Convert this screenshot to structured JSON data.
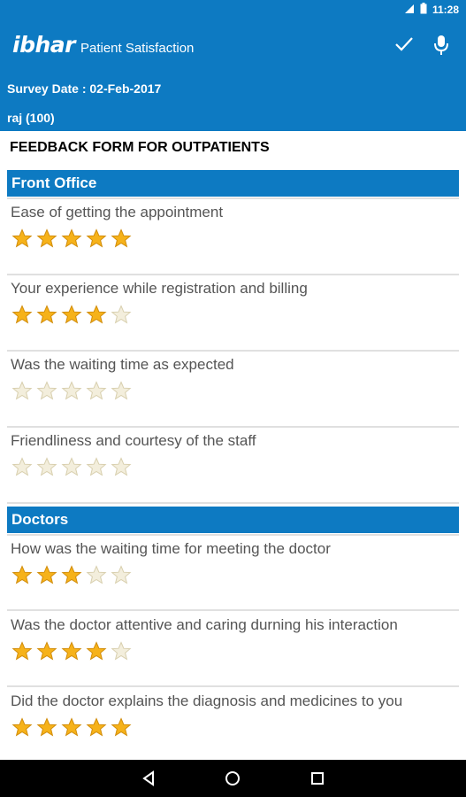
{
  "status_bar": {
    "time": "11:28"
  },
  "app_bar": {
    "logo": "ibhar",
    "title": "Patient Satisfaction",
    "survey_date": "Survey Date : 02-Feb-2017",
    "patient": "raj (100)"
  },
  "form_title": "FEEDBACK FORM FOR OUTPATIENTS",
  "colors": {
    "primary": "#0d7ac2",
    "star_filled": "#f6b21a",
    "star_empty": "#f3eedc"
  },
  "sections": [
    {
      "title": "Front Office",
      "questions": [
        {
          "text": "Ease of getting the appointment",
          "rating": 5
        },
        {
          "text": "Your experience while registration and billing",
          "rating": 4
        },
        {
          "text": "Was the waiting time as expected",
          "rating": 0
        },
        {
          "text": "Friendliness and courtesy of the staff",
          "rating": 0
        }
      ]
    },
    {
      "title": "Doctors",
      "questions": [
        {
          "text": "How was the waiting time for meeting the doctor",
          "rating": 3
        },
        {
          "text": "Was the doctor attentive and caring durning his interaction",
          "rating": 4
        },
        {
          "text": "Did the doctor explains the diagnosis and medicines to you",
          "rating": 5
        }
      ]
    }
  ],
  "rating_max": 5,
  "icons": {
    "check": "check-icon",
    "mic": "mic-icon",
    "back": "back-icon",
    "home": "home-icon",
    "recents": "recents-icon"
  }
}
